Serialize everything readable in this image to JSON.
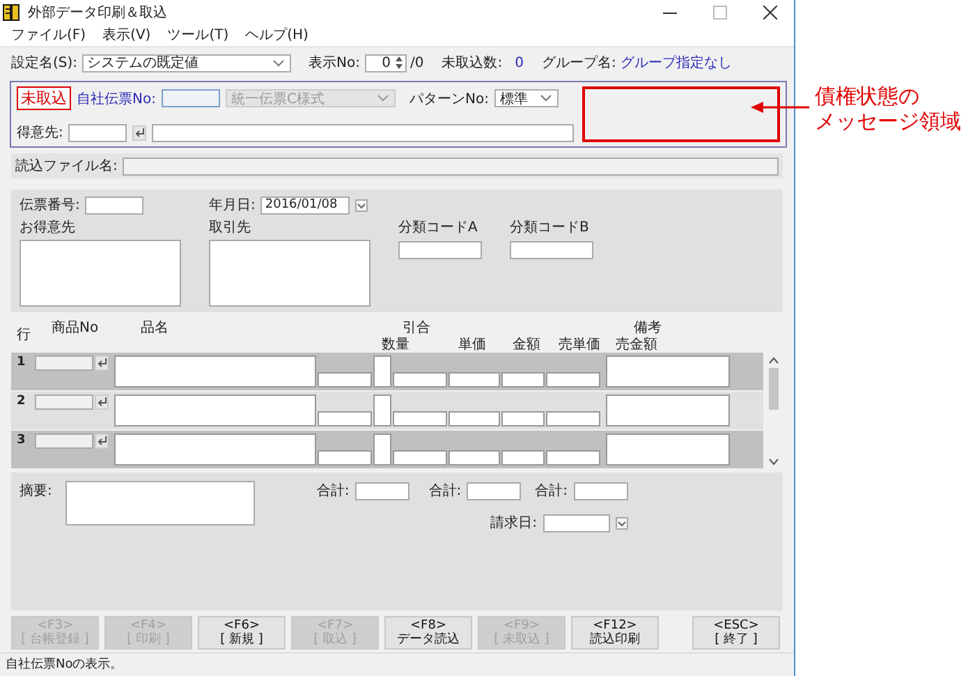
{
  "window": {
    "title": "外部データ印刷＆取込"
  },
  "menu": [
    "ファイル(F)",
    "表示(V)",
    "ツール(T)",
    "ヘルプ(H)"
  ],
  "settings": {
    "label": "設定名(S):",
    "value": "システムの既定値",
    "display_no_label": "表示No:",
    "display_no": "0",
    "display_total": "/0",
    "pending_label": "未取込数:",
    "pending_count": "0",
    "group_label": "グループ名:",
    "group_value": "グループ指定なし"
  },
  "voucher_panel": {
    "status_badge": "未取込",
    "own_no_label": "自社伝票No:",
    "format": {
      "value": "統一伝票C様式",
      "disabled": true
    },
    "pattern_label": "パターンNo:",
    "pattern": "標準",
    "customer_label": "得意先:"
  },
  "file_label": "読込ファイル名:",
  "header_form": {
    "voucher_no_label": "伝票番号:",
    "date_label": "年月日:",
    "date": "2016/01/08",
    "customer_label": "お得意先",
    "partner_label": "取引先",
    "code_a_label": "分類コードA",
    "code_b_label": "分類コードB"
  },
  "table": {
    "row_label": "行",
    "product_no": "商品No",
    "product_name": "品名",
    "inquiry": "引合",
    "remarks": "備考",
    "sub_columns": [
      "数量",
      "単価",
      "金額",
      "売単価",
      "売金額"
    ],
    "rows": [
      {
        "number": "1"
      },
      {
        "number": "2"
      },
      {
        "number": "3"
      }
    ]
  },
  "footer": {
    "summary_label": "摘要:",
    "total_labels": [
      "合計:",
      "合計:",
      "合計:"
    ],
    "billing_date_label": "請求日:"
  },
  "buttons": [
    {
      "key": "<F3>",
      "label": "[ 台帳登録 ]",
      "disabled": true
    },
    {
      "key": "<F4>",
      "label": "[ 印刷 ]",
      "disabled": true
    },
    {
      "key": "<F6>",
      "label": "[ 新規 ]",
      "disabled": false
    },
    {
      "key": "<F7>",
      "label": "[ 取込 ]",
      "disabled": true
    },
    {
      "key": "<F8>",
      "label": "データ読込",
      "disabled": false
    },
    {
      "key": "<F9>",
      "label": "[ 未取込 ]",
      "disabled": true
    },
    {
      "key": "<F12>",
      "label": "読込印刷",
      "disabled": false
    },
    {
      "key": "<ESC>",
      "label": "[ 終了 ]",
      "disabled": false
    }
  ],
  "status_bar": "自社伝票Noの表示。",
  "annotation": {
    "lines": [
      "債権状態の",
      "メッセージ領域"
    ]
  }
}
